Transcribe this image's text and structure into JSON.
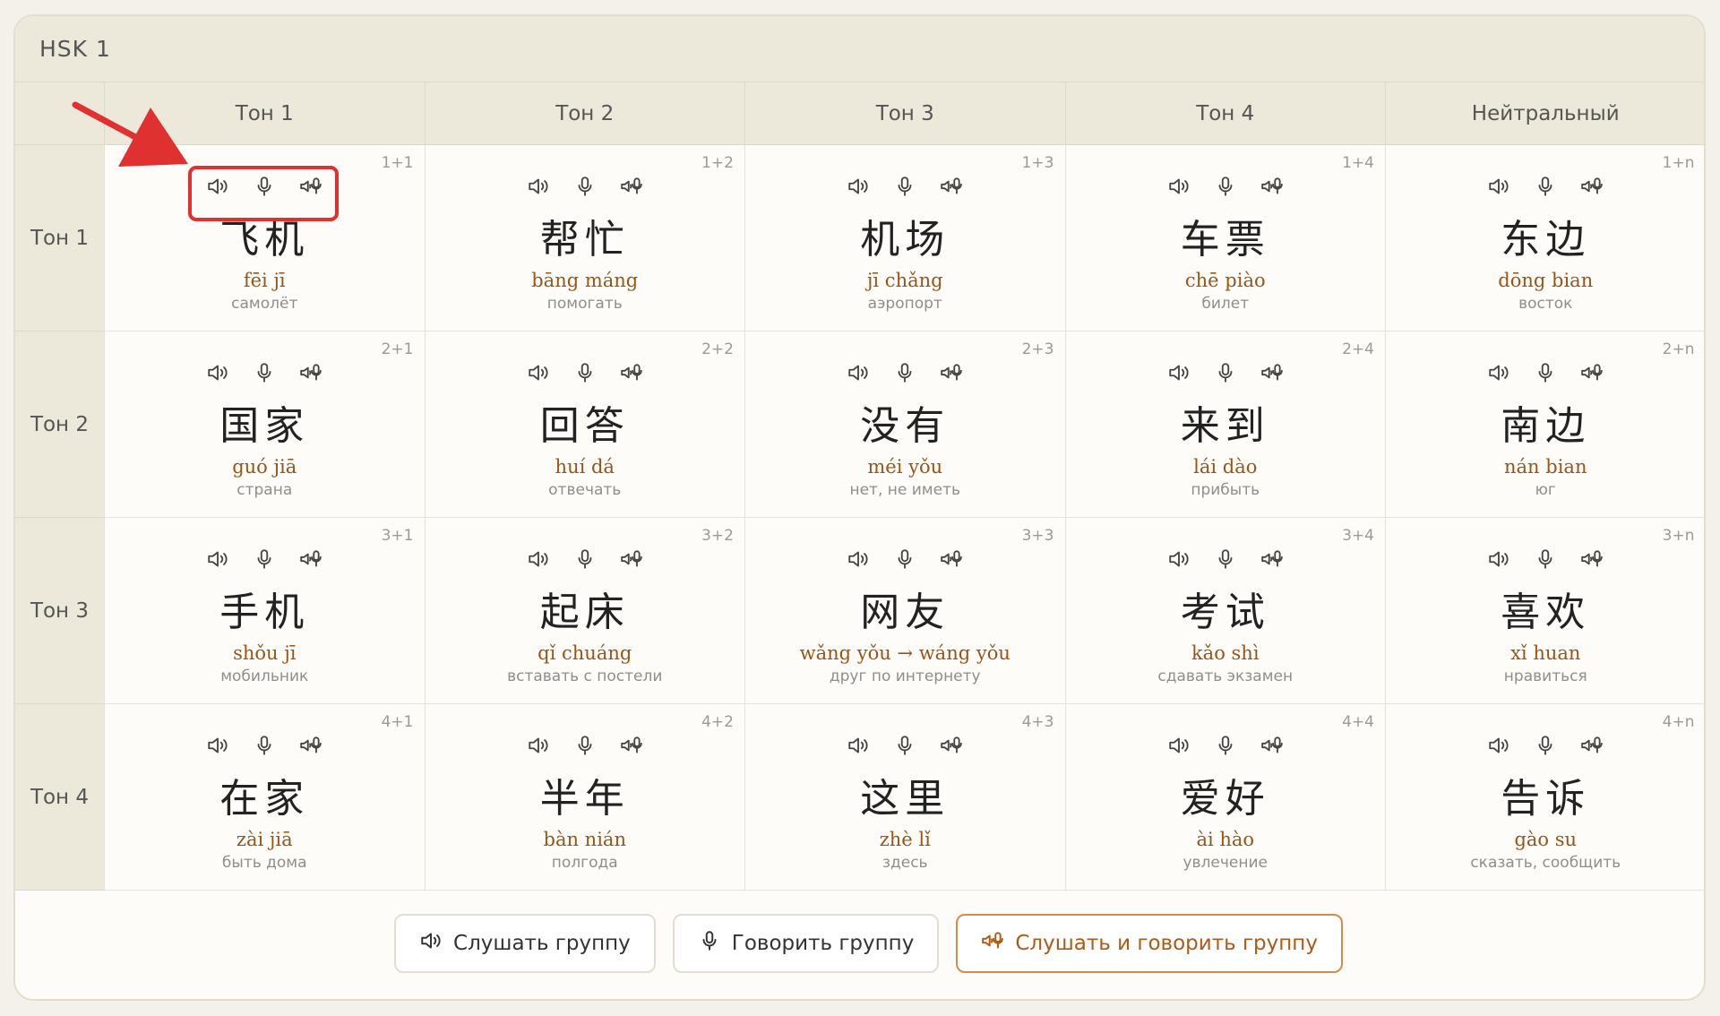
{
  "title": "HSK 1",
  "columns": [
    "Тон 1",
    "Тон 2",
    "Тон 3",
    "Тон 4",
    "Нейтральный"
  ],
  "rows": [
    {
      "label": "Тон 1",
      "cells": [
        {
          "combo": "1+1",
          "hanzi": "飞机",
          "pinyin": "fēi jī",
          "meaning": "самолёт"
        },
        {
          "combo": "1+2",
          "hanzi": "帮忙",
          "pinyin": "bāng máng",
          "meaning": "помогать"
        },
        {
          "combo": "1+3",
          "hanzi": "机场",
          "pinyin": "jī chǎng",
          "meaning": "аэропорт"
        },
        {
          "combo": "1+4",
          "hanzi": "车票",
          "pinyin": "chē piào",
          "meaning": "билет"
        },
        {
          "combo": "1+n",
          "hanzi": "东边",
          "pinyin": "dōng bian",
          "meaning": "восток"
        }
      ]
    },
    {
      "label": "Тон 2",
      "cells": [
        {
          "combo": "2+1",
          "hanzi": "国家",
          "pinyin": "guó jiā",
          "meaning": "страна"
        },
        {
          "combo": "2+2",
          "hanzi": "回答",
          "pinyin": "huí dá",
          "meaning": "отвечать"
        },
        {
          "combo": "2+3",
          "hanzi": "没有",
          "pinyin": "méi yǒu",
          "meaning": "нет, не иметь"
        },
        {
          "combo": "2+4",
          "hanzi": "来到",
          "pinyin": "lái dào",
          "meaning": "прибыть"
        },
        {
          "combo": "2+n",
          "hanzi": "南边",
          "pinyin": "nán bian",
          "meaning": "юг"
        }
      ]
    },
    {
      "label": "Тон 3",
      "cells": [
        {
          "combo": "3+1",
          "hanzi": "手机",
          "pinyin": "shǒu jī",
          "meaning": "мобильник"
        },
        {
          "combo": "3+2",
          "hanzi": "起床",
          "pinyin": "qǐ chuáng",
          "meaning": "вставать с постели"
        },
        {
          "combo": "3+3",
          "hanzi": "网友",
          "pinyin": "wǎng yǒu → wáng yǒu",
          "meaning": "друг по интернету"
        },
        {
          "combo": "3+4",
          "hanzi": "考试",
          "pinyin": "kǎo shì",
          "meaning": "сдавать экзамен"
        },
        {
          "combo": "3+n",
          "hanzi": "喜欢",
          "pinyin": "xǐ huan",
          "meaning": "нравиться"
        }
      ]
    },
    {
      "label": "Тон 4",
      "cells": [
        {
          "combo": "4+1",
          "hanzi": "在家",
          "pinyin": "zài jiā",
          "meaning": "быть дома"
        },
        {
          "combo": "4+2",
          "hanzi": "半年",
          "pinyin": "bàn nián",
          "meaning": "полгода"
        },
        {
          "combo": "4+3",
          "hanzi": "这里",
          "pinyin": "zhè lǐ",
          "meaning": "здесь"
        },
        {
          "combo": "4+4",
          "hanzi": "爱好",
          "pinyin": "ài hào",
          "meaning": "увлечение"
        },
        {
          "combo": "4+n",
          "hanzi": "告诉",
          "pinyin": "gào su",
          "meaning": "сказать, сообщить"
        }
      ]
    }
  ],
  "footer": {
    "listen_group": "Слушать группу",
    "speak_group": "Говорить группу",
    "listen_speak_group": "Слушать и говорить группу"
  },
  "colors": {
    "header_bg": "#ece8da",
    "pinyin": "#9a5416",
    "accent_border": "#d88a4a",
    "annotation": "#e03131"
  },
  "icons": {
    "listen": "speaker-icon",
    "speak": "microphone-icon",
    "listen_speak": "speaker-microphone-icon"
  }
}
